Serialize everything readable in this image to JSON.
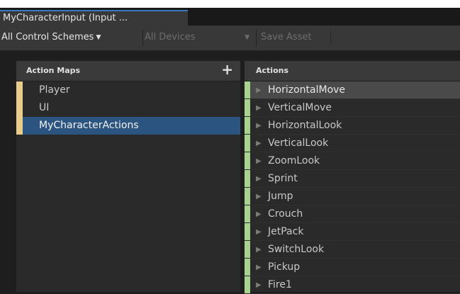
{
  "window": {
    "tab_title": "MyCharacterInput (Input ..."
  },
  "toolbar": {
    "control_schemes": "All Control Schemes",
    "devices": "All Devices",
    "save_asset": "Save Asset"
  },
  "action_maps": {
    "header": "Action Maps",
    "add_icon": "+",
    "items": [
      {
        "label": "Player"
      },
      {
        "label": "UI"
      },
      {
        "label": "MyCharacterActions",
        "selected": true
      }
    ]
  },
  "actions": {
    "header": "Actions",
    "items": [
      {
        "label": "HorizontalMove"
      },
      {
        "label": "VerticalMove"
      },
      {
        "label": "HorizontalLook"
      },
      {
        "label": "VerticalLook"
      },
      {
        "label": "ZoomLook"
      },
      {
        "label": "Sprint"
      },
      {
        "label": "Jump"
      },
      {
        "label": "Crouch"
      },
      {
        "label": "JetPack"
      },
      {
        "label": "SwitchLook"
      },
      {
        "label": "Pickup"
      },
      {
        "label": "Fire1"
      }
    ]
  },
  "colors": {
    "selection": "#2b5580",
    "map_marker": "#e8cc8a",
    "action_marker": "#a7d38f",
    "tab_accent": "#3a79bb"
  },
  "icons": {
    "dropdown": "caret-down-icon",
    "expand": "triangle-right-icon",
    "add": "plus-icon"
  }
}
